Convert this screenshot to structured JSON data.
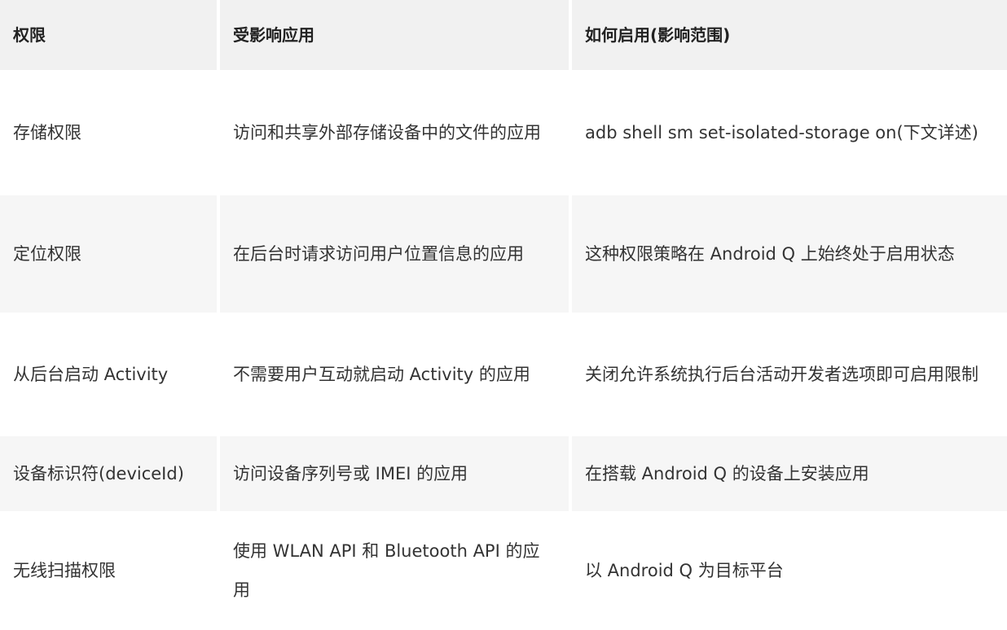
{
  "table": {
    "headers": [
      "权限",
      "受影响应用",
      "如何启用(影响范围)"
    ],
    "rows": [
      [
        "存储权限",
        "访问和共享外部存储设备中的文件的应用",
        "adb shell sm set-isolated-storage on(下文详述)"
      ],
      [
        "定位权限",
        "在后台时请求访问用户位置信息的应用",
        "这种权限策略在 Android Q 上始终处于启用状态"
      ],
      [
        "从后台启动 Activity",
        "不需要用户互动就启动 Activity 的应用",
        "关闭允许系统执行后台活动开发者选项即可启用限制"
      ],
      [
        "设备标识符(deviceId)",
        "访问设备序列号或 IMEI 的应用",
        "在搭载 Android Q 的设备上安装应用"
      ],
      [
        "无线扫描权限",
        "使用 WLAN API 和 Bluetooth API 的应用",
        "以 Android Q 为目标平台"
      ]
    ]
  }
}
